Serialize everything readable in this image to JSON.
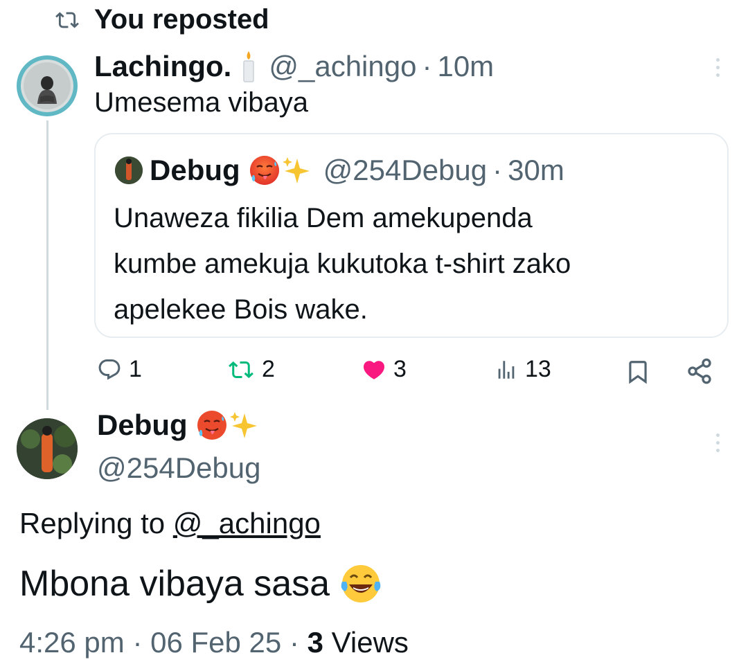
{
  "repost_banner": {
    "label": "You reposted",
    "icon": "repost-icon"
  },
  "parent_tweet": {
    "display_name": "Lachingo.",
    "name_emoji": "candle-icon",
    "handle": "@_achingo",
    "separator": "·",
    "time": "10m",
    "text": "Umesema vibaya",
    "quote": {
      "display_name": "Debug",
      "name_emojis": [
        "hot-face-emoji",
        "sparkles-emoji"
      ],
      "handle": "@254Debug",
      "separator": "·",
      "time": "30m",
      "text_lines": [
        "Unaweza fikilia Dem amekupenda",
        "kumbe amekuja kukutoka t-shirt zako",
        "apelekee Bois wake."
      ]
    },
    "actions": {
      "replies": "1",
      "reposts": "2",
      "likes": "3",
      "views": "13"
    },
    "colors": {
      "repost_green": "#00ba7c",
      "like_pink": "#f91880",
      "grey": "#536471"
    }
  },
  "reply_tweet": {
    "display_name": "Debug",
    "name_emojis": [
      "hot-face-emoji",
      "sparkles-emoji"
    ],
    "handle": "@254Debug",
    "replying_prefix": "Replying to",
    "replying_handle": "@_achingo",
    "text": "Mbona vibaya sasa",
    "text_emoji": "tears-of-joy-emoji",
    "time": "4:26 pm",
    "sep1": "·",
    "date": "06 Feb 25",
    "sep2": "·",
    "views_count": "3",
    "views_label": "Views"
  }
}
